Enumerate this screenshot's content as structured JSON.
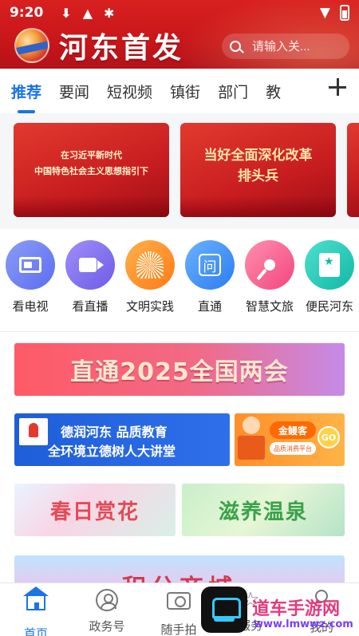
{
  "status_bar": {
    "time": "9:20"
  },
  "header": {
    "brand": "河东首发",
    "search_placeholder": "请输入关..."
  },
  "tabs": [
    {
      "label": "推荐",
      "active": true
    },
    {
      "label": "要闻"
    },
    {
      "label": "短视频"
    },
    {
      "label": "镇街"
    },
    {
      "label": "部门"
    },
    {
      "label": "教"
    }
  ],
  "carousel": [
    {
      "line1": "在习近平新时代",
      "line2": "中国特色社会主义思想指引下"
    },
    {
      "line1": "当好全面深化改革",
      "line2": "排头兵"
    }
  ],
  "services": [
    {
      "label": "看电视",
      "icon": "tv-icon"
    },
    {
      "label": "看直播",
      "icon": "video-icon"
    },
    {
      "label": "文明实践",
      "icon": "fan-icon"
    },
    {
      "label": "直通",
      "icon": "ask-icon"
    },
    {
      "label": "智慧文旅",
      "icon": "microphone-icon"
    },
    {
      "label": "便民河东",
      "icon": "bookmark-icon"
    }
  ],
  "banners": {
    "two_sessions": "直通2025全国两会",
    "education_line1": "德润河东 品质教育",
    "education_line2": "全环境立德树人大讲堂",
    "gold_title": "金鳗客",
    "gold_sub": "品质消费平台",
    "gold_go": "GO",
    "spring_flowers": "春日赏花",
    "hot_spring": "滋养温泉",
    "points_mall": "积分商城"
  },
  "bottom_nav": [
    {
      "label": "首页",
      "active": true
    },
    {
      "label": "政务号"
    },
    {
      "label": "随手拍"
    },
    {
      "label": "服务"
    },
    {
      "label": "我的"
    }
  ],
  "watermark": {
    "text": "道车手游网",
    "url": "www.lmwwz.com"
  }
}
